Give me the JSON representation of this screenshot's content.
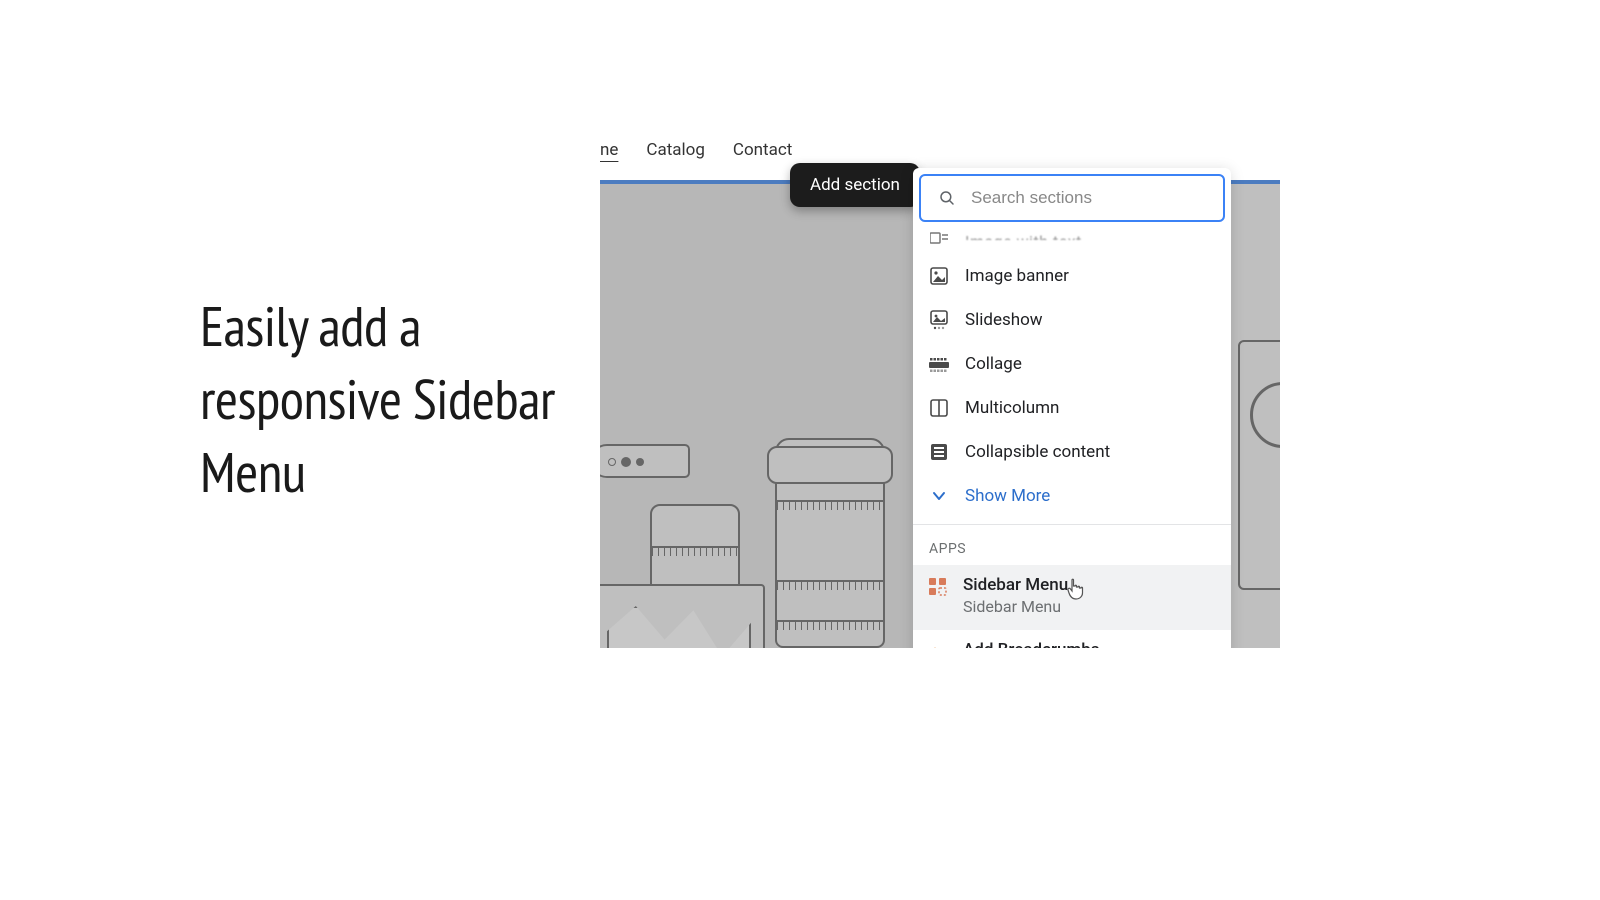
{
  "promo": {
    "headline": "Easily add a responsive Sidebar Menu"
  },
  "nav": {
    "link1_partial": "ne",
    "link2": "Catalog",
    "link3": "Contact"
  },
  "tooltip": {
    "label": "Add section"
  },
  "search": {
    "placeholder": "Search sections"
  },
  "cutoff": {
    "label": "Image with text"
  },
  "sections": [
    {
      "label": "Image banner"
    },
    {
      "label": "Slideshow"
    },
    {
      "label": "Collage"
    },
    {
      "label": "Multicolumn"
    },
    {
      "label": "Collapsible content"
    }
  ],
  "show_more": {
    "label": "Show More"
  },
  "group": {
    "label": "APPS"
  },
  "apps": [
    {
      "title": "Sidebar Menu",
      "subtitle": "Sidebar Menu"
    },
    {
      "title": "Add Breadcrumbs"
    }
  ]
}
